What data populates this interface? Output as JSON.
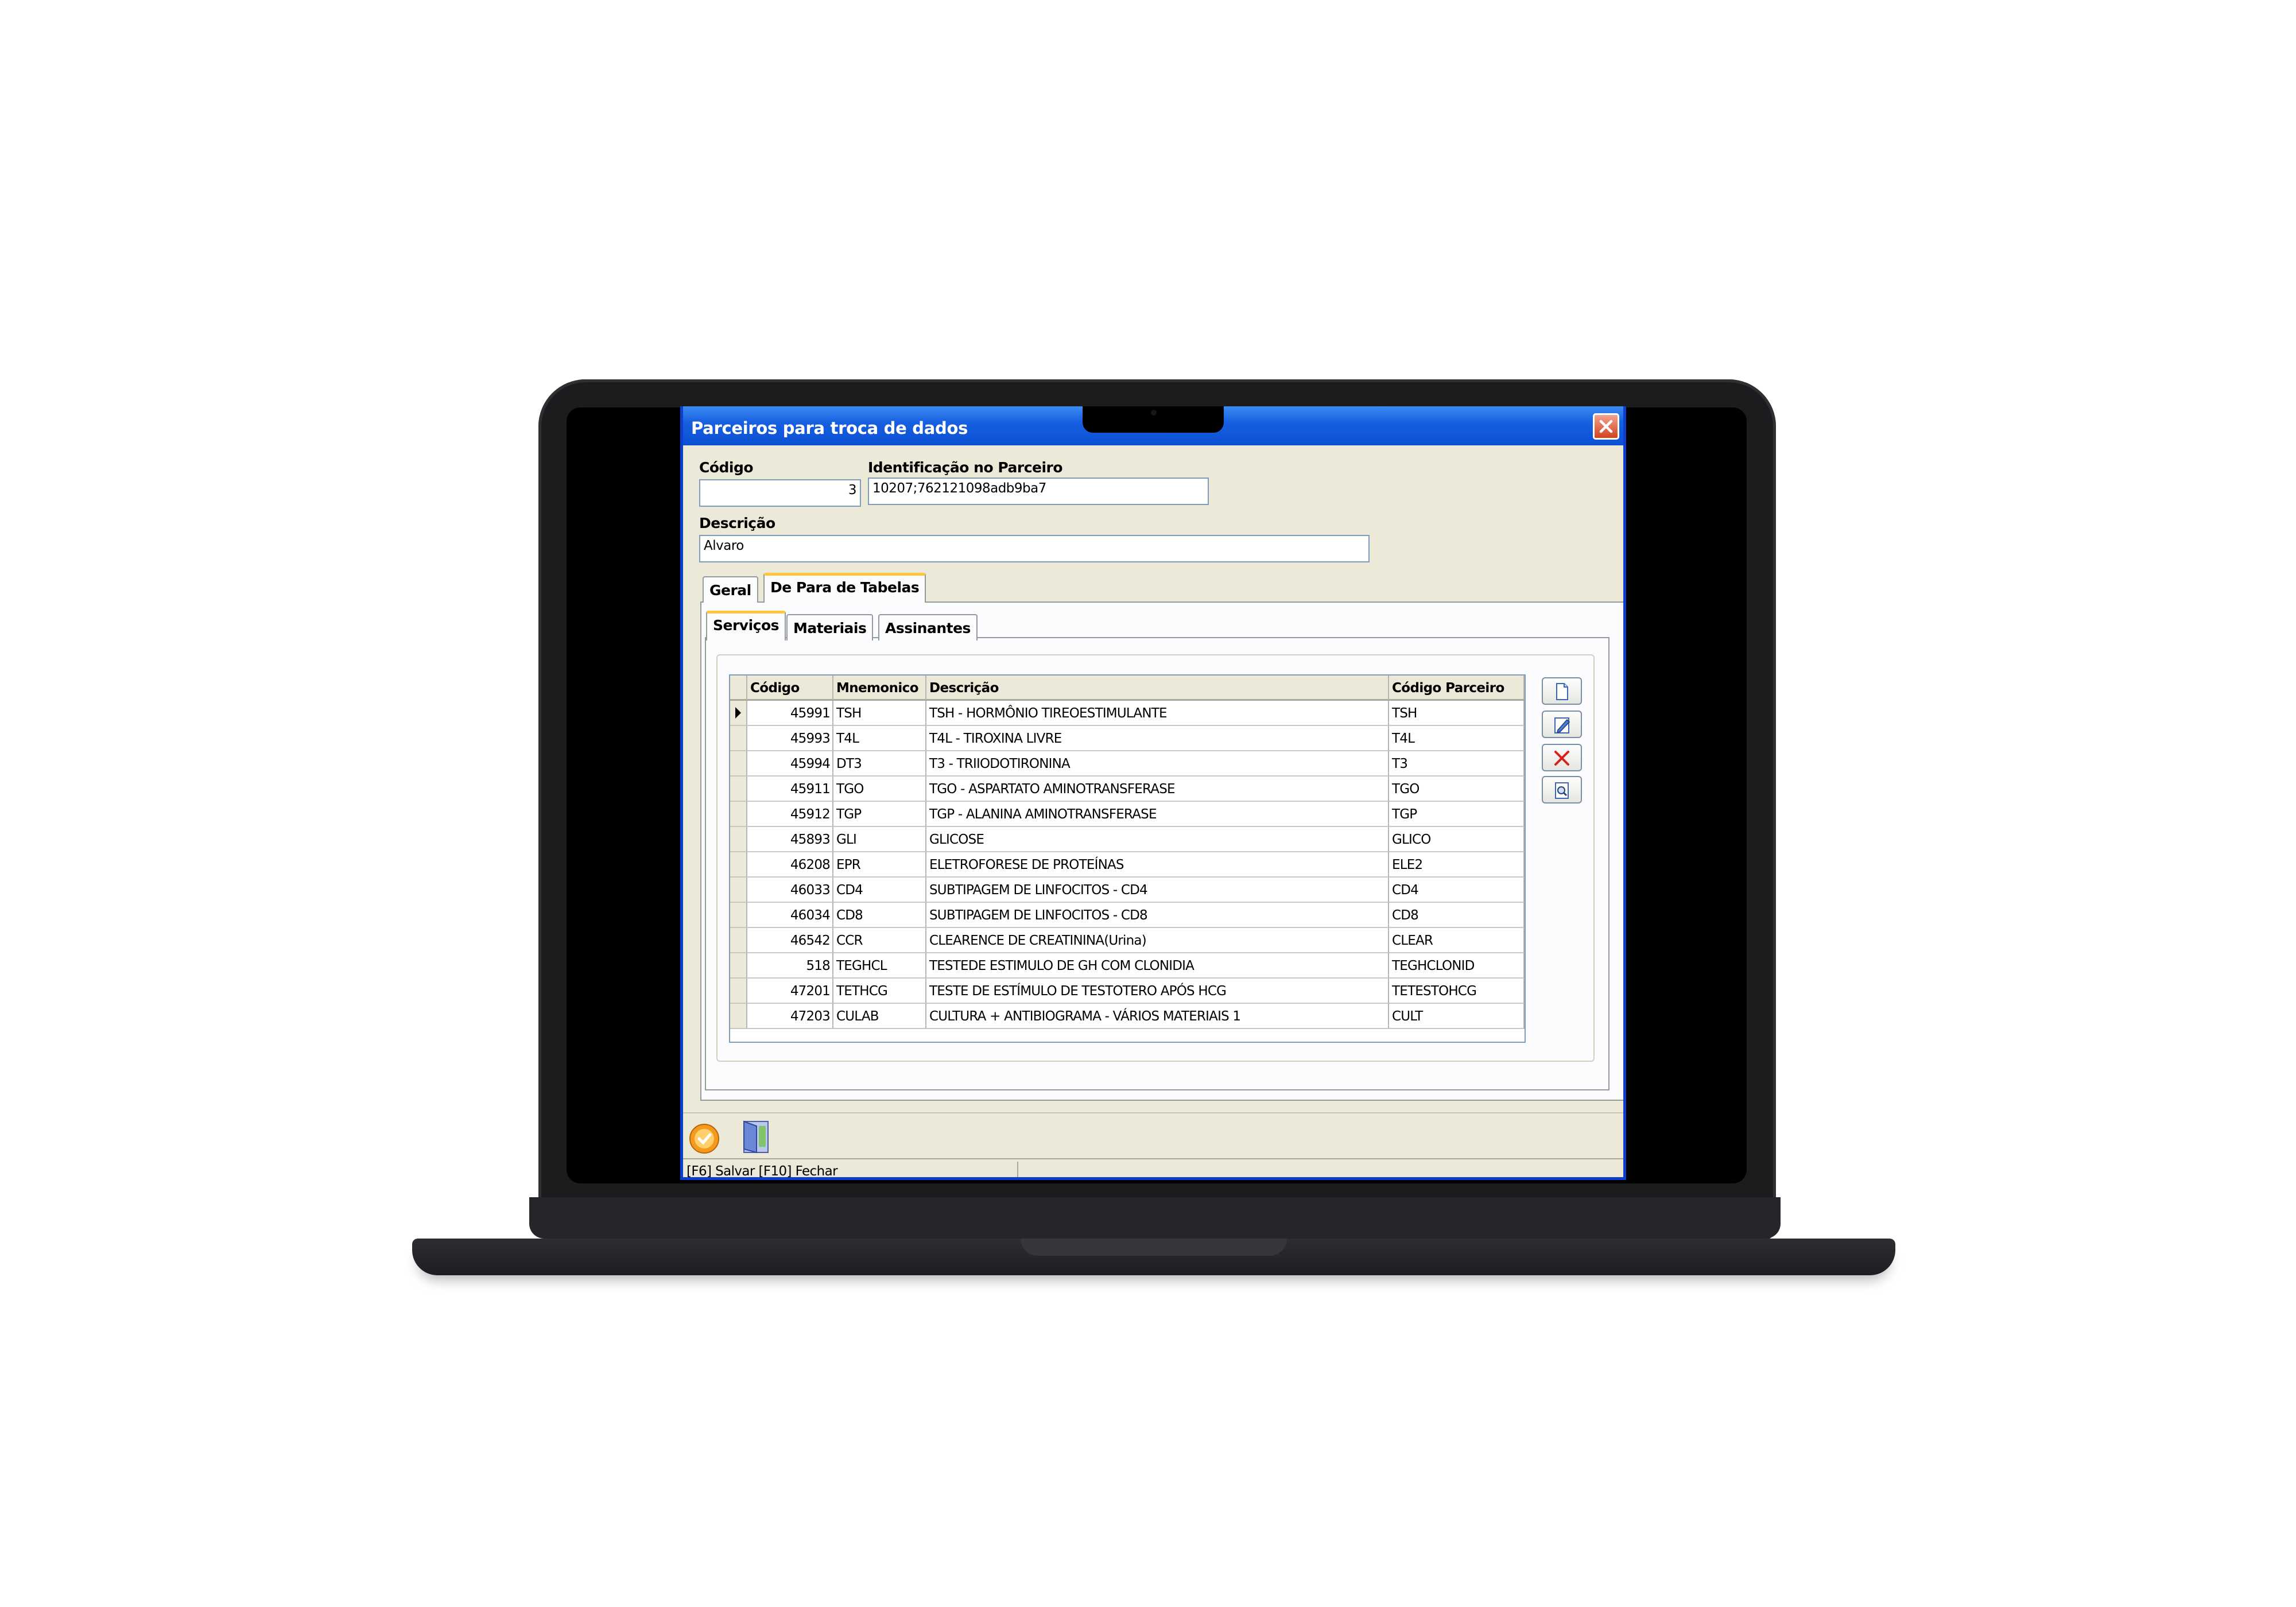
{
  "window": {
    "title": "Parceiros para troca de dados"
  },
  "form": {
    "codigo_label": "Código",
    "codigo_value": "3",
    "identificacao_label": "Identificação no Parceiro",
    "identificacao_value": "10207;762121098adb9ba7",
    "descricao_label": "Descrição",
    "descricao_value": "Alvaro"
  },
  "tabs": {
    "outer": [
      "Geral",
      "De Para de Tabelas"
    ],
    "outer_active": "De Para de Tabelas",
    "inner": [
      "Serviços",
      "Materiais",
      "Assinantes"
    ],
    "inner_active": "Serviços"
  },
  "grid": {
    "columns": [
      "Código",
      "Mnemonico",
      "Descrição",
      "Código Parceiro"
    ],
    "rows": [
      {
        "codigo": "45991",
        "mnemonico": "TSH",
        "descricao": "TSH - HORMÔNIO TIREOESTIMULANTE",
        "parceiro": "TSH"
      },
      {
        "codigo": "45993",
        "mnemonico": "T4L",
        "descricao": "T4L - TIROXINA LIVRE",
        "parceiro": "T4L"
      },
      {
        "codigo": "45994",
        "mnemonico": "DT3",
        "descricao": "T3 - TRIIODOTIRONINA",
        "parceiro": "T3"
      },
      {
        "codigo": "45911",
        "mnemonico": "TGO",
        "descricao": "TGO - ASPARTATO AMINOTRANSFERASE",
        "parceiro": "TGO"
      },
      {
        "codigo": "45912",
        "mnemonico": "TGP",
        "descricao": "TGP - ALANINA AMINOTRANSFERASE",
        "parceiro": "TGP"
      },
      {
        "codigo": "45893",
        "mnemonico": "GLI",
        "descricao": "GLICOSE",
        "parceiro": "GLICO"
      },
      {
        "codigo": "46208",
        "mnemonico": "EPR",
        "descricao": "ELETROFORESE DE PROTEÍNAS",
        "parceiro": "ELE2"
      },
      {
        "codigo": "46033",
        "mnemonico": "CD4",
        "descricao": "SUBTIPAGEM DE LINFOCITOS - CD4",
        "parceiro": "CD4"
      },
      {
        "codigo": "46034",
        "mnemonico": "CD8",
        "descricao": "SUBTIPAGEM DE LINFOCITOS - CD8",
        "parceiro": "CD8"
      },
      {
        "codigo": "46542",
        "mnemonico": "CCR",
        "descricao": "CLEARENCE DE CREATININA(Urina)",
        "parceiro": "CLEAR"
      },
      {
        "codigo": "518",
        "mnemonico": "TEGHCL",
        "descricao": "TESTEDE ESTIMULO DE GH COM CLONIDIA",
        "parceiro": "TEGHCLONID"
      },
      {
        "codigo": "47201",
        "mnemonico": "TETHCG",
        "descricao": "TESTE DE ESTÍMULO DE TESTOTERO APÓS HCG",
        "parceiro": "TETESTOHCG"
      },
      {
        "codigo": "47203",
        "mnemonico": "CULAB",
        "descricao": "CULTURA + ANTIBIOGRAMA - VÁRIOS MATERIAIS 1",
        "parceiro": "CULT"
      }
    ]
  },
  "side_buttons": [
    "new-record-icon",
    "edit-record-icon",
    "delete-record-icon",
    "search-record-icon"
  ],
  "toolbar_icons": [
    "save-check-icon",
    "exit-door-icon"
  ],
  "status": {
    "text": "[F6] Salvar [F10] Fechar"
  },
  "colors": {
    "titlebar": "#0c4fd3",
    "window_bg": "#ece9d8",
    "active_tab": "#ffc83c",
    "delete_icon": "#d8211a"
  }
}
